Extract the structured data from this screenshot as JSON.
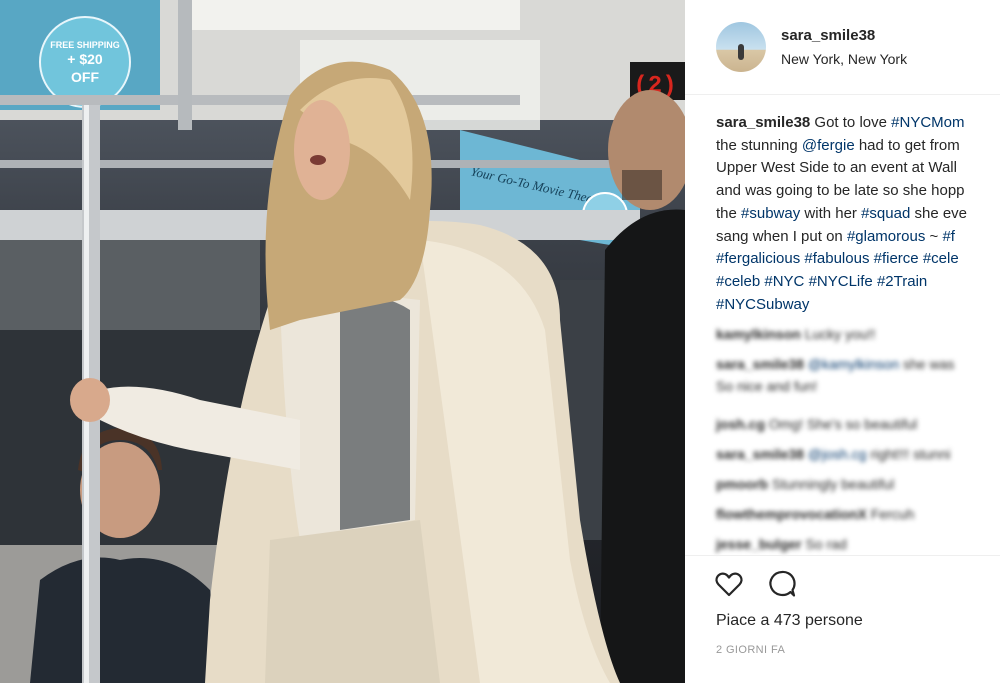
{
  "post": {
    "username": "sara_smile38",
    "location": "New York, New York",
    "photo_signs": {
      "ad_left": "FREE SHIPPING + $20 OFF",
      "ad_right": "Your Go-To Movie Theater",
      "train_number": "2"
    },
    "caption_lines": [
      [
        "Got to love ",
        "#NYCMom"
      ],
      [
        "the stunning ",
        "@fergie",
        " had to get from"
      ],
      [
        "Upper West Side to an event at Wall"
      ],
      [
        "and was going to be late so she hopp"
      ],
      [
        "the ",
        "#subway",
        " with her ",
        "#squad",
        " she eve"
      ],
      [
        "sang when I put on ",
        "#glamorous",
        " ~ ",
        "#f"
      ],
      [
        "#fergalicious",
        " ",
        "#fabulous",
        " ",
        "#fierce",
        " ",
        "#cele"
      ],
      [
        "#celeb",
        " ",
        "#NYC",
        " ",
        "#NYCLife",
        " ",
        "#2Train"
      ],
      [
        "#NYCSubway"
      ]
    ],
    "comments": [
      {
        "user": "kamylkinson",
        "text": "Lucky you!!"
      },
      {
        "user": "sara_smile38",
        "mention": "@kamylkinson",
        "text": "she was",
        "text2": "So nice and fun!"
      },
      {
        "user": "josh.cg",
        "text": "Omg! She's so beautiful"
      },
      {
        "user": "sara_smile38",
        "mention": "@josh.cg",
        "text": "right!!! stunni"
      },
      {
        "user": "pmoorb",
        "text": "Stunningly beautiful"
      },
      {
        "user": "flowthemprovocationX",
        "text": "Fercuh"
      },
      {
        "user": "jesse_bulger",
        "text": "So rad"
      }
    ],
    "likes": "Piace a 473 persone",
    "timestamp": "2 GIORNI FA"
  },
  "icons": {
    "like": "heart-icon",
    "comment": "speech-bubble-icon"
  },
  "colors": {
    "text": "#262626",
    "hashtag": "#003569",
    "muted": "#999999",
    "divider": "#efefef"
  }
}
